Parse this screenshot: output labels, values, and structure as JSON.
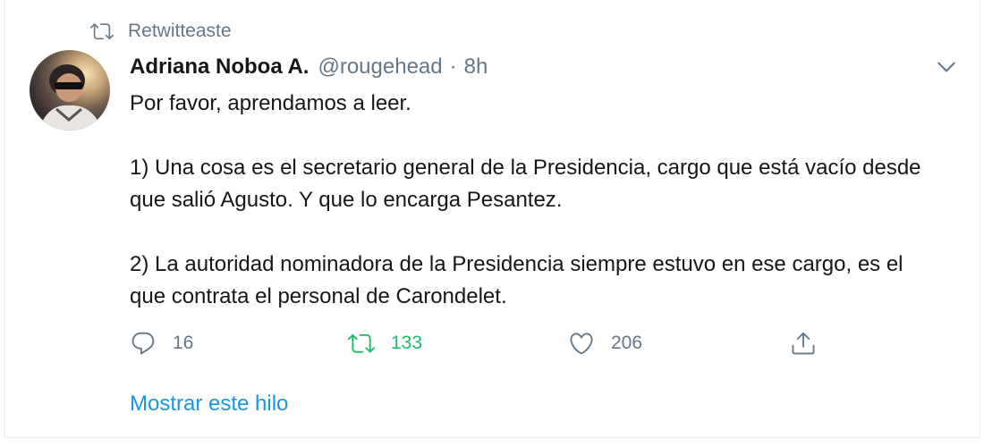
{
  "retweet_context": {
    "icon": "retweet-icon",
    "label": "Retwitteaste"
  },
  "author": {
    "avatar_icon": "avatar",
    "display_name": "Adriana Noboa A.",
    "handle": "@rougehead",
    "separator": "·",
    "time": "8h"
  },
  "menu": {
    "icon": "chevron-down-icon"
  },
  "tweet": {
    "lines": [
      "Por favor, aprendamos a leer.",
      "",
      "1) Una cosa es el secretario general de la Presidencia, cargo que está vacío desde que salió Agusto. Y que lo encarga Pesantez.",
      "",
      "2) La autoridad nominadora de la Presidencia siempre estuvo en ese cargo, es el que contrata el personal de Carondelet."
    ]
  },
  "actions": {
    "reply": {
      "icon": "reply-icon",
      "count": "16"
    },
    "retweet": {
      "icon": "retweet-icon",
      "count": "133",
      "active_color": "#17bf63"
    },
    "like": {
      "icon": "heart-icon",
      "count": "206"
    },
    "share": {
      "icon": "share-icon"
    }
  },
  "show_thread": {
    "label": "Mostrar este hilo",
    "color": "#1b95e0"
  }
}
